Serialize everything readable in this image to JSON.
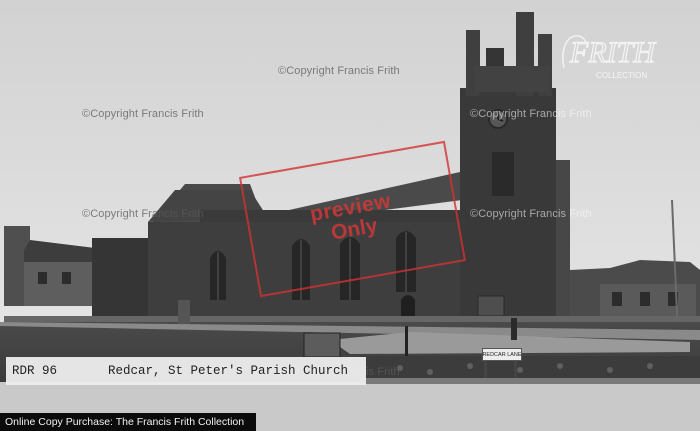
{
  "photo": {
    "subject": "St Peter's Parish Church",
    "caption_code": "RDR 96",
    "caption_title": "Redcar, St Peter's Parish Church"
  },
  "watermarks": {
    "copyright_text": "©Copyright Francis Frith",
    "preview_line1": "preview",
    "preview_line2": "Only",
    "logo_text": "FRITH",
    "logo_sub": "COLLECTION",
    "stamp_color": "#d73737"
  },
  "street_sign": {
    "text": "REDCAR LANE"
  },
  "footer": {
    "text": "Online Copy Purchase: The Francis Frith Collection"
  }
}
